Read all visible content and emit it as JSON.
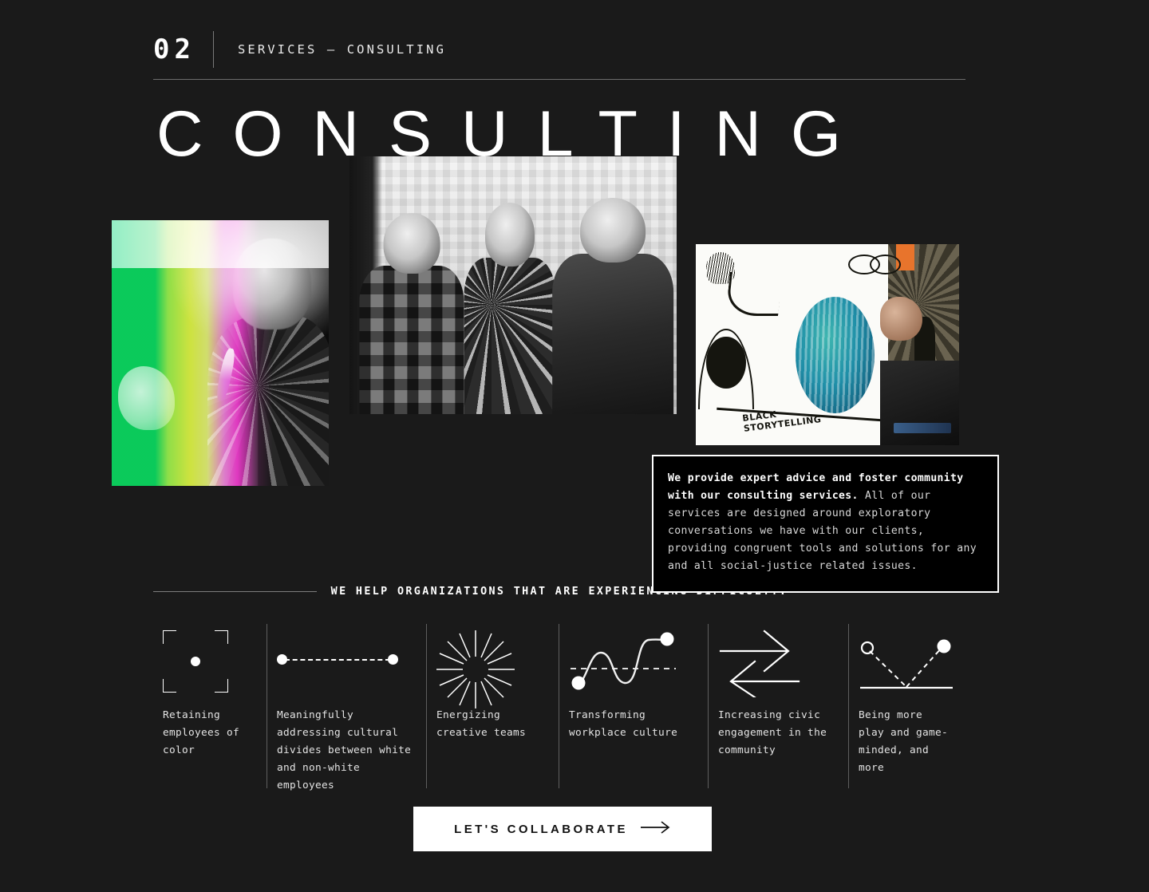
{
  "header": {
    "number": "02",
    "label": "SERVICES — CONSULTING"
  },
  "title": "CONSULTING",
  "images": [
    {
      "name": "speaker-with-microphone-gradient",
      "caption": ""
    },
    {
      "name": "three-men-in-conversation-bw",
      "caption": ""
    },
    {
      "name": "whiteboard-illustration",
      "caption": "BLACK\nSTORYTELLING"
    }
  ],
  "description": {
    "bold": "We provide expert advice and foster community with our consulting services.",
    "rest": " All of our services are designed around exploratory conversations we have with our clients, providing congruent tools and solutions for any and all social-justice related issues."
  },
  "section_divider": {
    "text": "WE HELP ORGANIZATIONS THAT ARE EXPERIENCING DIFFICULTY:"
  },
  "columns": [
    {
      "icon": "focus-brackets-icon",
      "label": "Retaining employees of color"
    },
    {
      "icon": "dashed-connector-icon",
      "label": "Meaningfully addressing cultural divides between white and non-white employees"
    },
    {
      "icon": "starburst-icon",
      "label": "Energizing creative teams"
    },
    {
      "icon": "s-curve-icon",
      "label": "Transforming workplace culture"
    },
    {
      "icon": "exchange-arrows-icon",
      "label": "Increasing civic engagement in the community"
    },
    {
      "icon": "bounce-trajectory-icon",
      "label": "Being more play and game-minded, and more"
    }
  ],
  "cta": {
    "label": "LET'S COLLABORATE",
    "icon": "arrow-right-icon"
  },
  "colors": {
    "background": "#1a1a1a",
    "text": "#ffffff",
    "muted": "#7d7d7d",
    "box_fill": "#000000",
    "cta_background": "#ffffff",
    "cta_text": "#111111"
  }
}
